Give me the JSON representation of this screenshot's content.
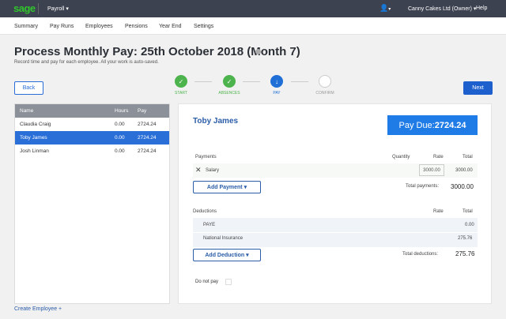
{
  "header": {
    "logo": "sage",
    "product": "Payroll ▾",
    "user_menu": "▾",
    "company": "Canny Cakes Ltd (Owner) ▾",
    "help": "Help"
  },
  "nav": [
    "Summary",
    "Pay Runs",
    "Employees",
    "Pensions",
    "Year End",
    "Settings"
  ],
  "page": {
    "title": "Process Monthly Pay: 25th October 2018 (Month 7)",
    "subtitle": "Record time and pay for each employee. All your work is auto-saved.",
    "back": "Back",
    "next": "Next"
  },
  "steps": [
    {
      "label": "START",
      "state": "done"
    },
    {
      "label": "ABSENCES",
      "state": "done"
    },
    {
      "label": "PAY",
      "state": "current"
    },
    {
      "label": "CONFIRM",
      "state": "todo"
    }
  ],
  "employees": {
    "headers": [
      "Name",
      "Hours",
      "Pay"
    ],
    "rows": [
      [
        "Claudia Craig",
        "0.00",
        "2724.24"
      ],
      [
        "Toby James",
        "0.00",
        "2724.24"
      ],
      [
        "Josh Linman",
        "0.00",
        "2724.24"
      ]
    ],
    "selected": 1,
    "create": "Create Employee +"
  },
  "detail": {
    "name": "Toby James",
    "pay_due_label": "Pay Due: ",
    "pay_due": "2724.24",
    "payments": {
      "header": "Payments",
      "cols": [
        "Quantity",
        "Rate",
        "Total"
      ],
      "items": [
        {
          "name": "Salary",
          "rate": "3000.00",
          "total": "3000.00"
        }
      ],
      "add": "Add Payment ▾",
      "total_label": "Total payments:",
      "total": "3000.00"
    },
    "deductions": {
      "header": "Deductions",
      "cols": [
        "Rate",
        "Total"
      ],
      "items": [
        {
          "name": "PAYE",
          "total": "0.00"
        },
        {
          "name": "National Insurance",
          "total": "275.76"
        }
      ],
      "add": "Add Deduction ▾",
      "total_label": "Total deductions:",
      "total": "275.76"
    },
    "do_not_pay": "Do not pay"
  }
}
